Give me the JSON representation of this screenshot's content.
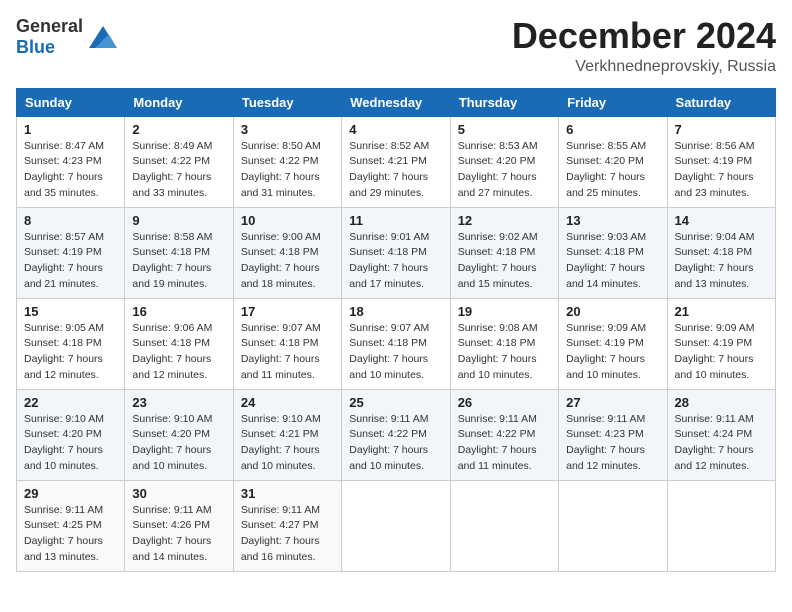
{
  "header": {
    "logo_general": "General",
    "logo_blue": "Blue",
    "month": "December 2024",
    "location": "Verkhnedneprovskiy, Russia"
  },
  "weekdays": [
    "Sunday",
    "Monday",
    "Tuesday",
    "Wednesday",
    "Thursday",
    "Friday",
    "Saturday"
  ],
  "weeks": [
    [
      {
        "day": "1",
        "sunrise": "8:47 AM",
        "sunset": "4:23 PM",
        "daylight": "7 hours and 35 minutes."
      },
      {
        "day": "2",
        "sunrise": "8:49 AM",
        "sunset": "4:22 PM",
        "daylight": "7 hours and 33 minutes."
      },
      {
        "day": "3",
        "sunrise": "8:50 AM",
        "sunset": "4:22 PM",
        "daylight": "7 hours and 31 minutes."
      },
      {
        "day": "4",
        "sunrise": "8:52 AM",
        "sunset": "4:21 PM",
        "daylight": "7 hours and 29 minutes."
      },
      {
        "day": "5",
        "sunrise": "8:53 AM",
        "sunset": "4:20 PM",
        "daylight": "7 hours and 27 minutes."
      },
      {
        "day": "6",
        "sunrise": "8:55 AM",
        "sunset": "4:20 PM",
        "daylight": "7 hours and 25 minutes."
      },
      {
        "day": "7",
        "sunrise": "8:56 AM",
        "sunset": "4:19 PM",
        "daylight": "7 hours and 23 minutes."
      }
    ],
    [
      {
        "day": "8",
        "sunrise": "8:57 AM",
        "sunset": "4:19 PM",
        "daylight": "7 hours and 21 minutes."
      },
      {
        "day": "9",
        "sunrise": "8:58 AM",
        "sunset": "4:18 PM",
        "daylight": "7 hours and 19 minutes."
      },
      {
        "day": "10",
        "sunrise": "9:00 AM",
        "sunset": "4:18 PM",
        "daylight": "7 hours and 18 minutes."
      },
      {
        "day": "11",
        "sunrise": "9:01 AM",
        "sunset": "4:18 PM",
        "daylight": "7 hours and 17 minutes."
      },
      {
        "day": "12",
        "sunrise": "9:02 AM",
        "sunset": "4:18 PM",
        "daylight": "7 hours and 15 minutes."
      },
      {
        "day": "13",
        "sunrise": "9:03 AM",
        "sunset": "4:18 PM",
        "daylight": "7 hours and 14 minutes."
      },
      {
        "day": "14",
        "sunrise": "9:04 AM",
        "sunset": "4:18 PM",
        "daylight": "7 hours and 13 minutes."
      }
    ],
    [
      {
        "day": "15",
        "sunrise": "9:05 AM",
        "sunset": "4:18 PM",
        "daylight": "7 hours and 12 minutes."
      },
      {
        "day": "16",
        "sunrise": "9:06 AM",
        "sunset": "4:18 PM",
        "daylight": "7 hours and 12 minutes."
      },
      {
        "day": "17",
        "sunrise": "9:07 AM",
        "sunset": "4:18 PM",
        "daylight": "7 hours and 11 minutes."
      },
      {
        "day": "18",
        "sunrise": "9:07 AM",
        "sunset": "4:18 PM",
        "daylight": "7 hours and 10 minutes."
      },
      {
        "day": "19",
        "sunrise": "9:08 AM",
        "sunset": "4:18 PM",
        "daylight": "7 hours and 10 minutes."
      },
      {
        "day": "20",
        "sunrise": "9:09 AM",
        "sunset": "4:19 PM",
        "daylight": "7 hours and 10 minutes."
      },
      {
        "day": "21",
        "sunrise": "9:09 AM",
        "sunset": "4:19 PM",
        "daylight": "7 hours and 10 minutes."
      }
    ],
    [
      {
        "day": "22",
        "sunrise": "9:10 AM",
        "sunset": "4:20 PM",
        "daylight": "7 hours and 10 minutes."
      },
      {
        "day": "23",
        "sunrise": "9:10 AM",
        "sunset": "4:20 PM",
        "daylight": "7 hours and 10 minutes."
      },
      {
        "day": "24",
        "sunrise": "9:10 AM",
        "sunset": "4:21 PM",
        "daylight": "7 hours and 10 minutes."
      },
      {
        "day": "25",
        "sunrise": "9:11 AM",
        "sunset": "4:22 PM",
        "daylight": "7 hours and 10 minutes."
      },
      {
        "day": "26",
        "sunrise": "9:11 AM",
        "sunset": "4:22 PM",
        "daylight": "7 hours and 11 minutes."
      },
      {
        "day": "27",
        "sunrise": "9:11 AM",
        "sunset": "4:23 PM",
        "daylight": "7 hours and 12 minutes."
      },
      {
        "day": "28",
        "sunrise": "9:11 AM",
        "sunset": "4:24 PM",
        "daylight": "7 hours and 12 minutes."
      }
    ],
    [
      {
        "day": "29",
        "sunrise": "9:11 AM",
        "sunset": "4:25 PM",
        "daylight": "7 hours and 13 minutes."
      },
      {
        "day": "30",
        "sunrise": "9:11 AM",
        "sunset": "4:26 PM",
        "daylight": "7 hours and 14 minutes."
      },
      {
        "day": "31",
        "sunrise": "9:11 AM",
        "sunset": "4:27 PM",
        "daylight": "7 hours and 16 minutes."
      },
      null,
      null,
      null,
      null
    ]
  ]
}
